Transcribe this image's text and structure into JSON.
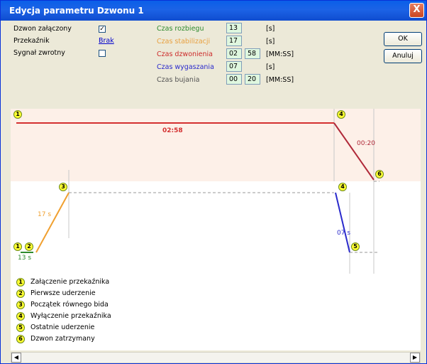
{
  "window": {
    "title": "Edycja parametru Dzwonu 1",
    "close_label": "X"
  },
  "left": {
    "bell_enabled_label": "Dzwon załączony",
    "relay_label": "Przekaźnik",
    "relay_value": "Brak",
    "feedback_label": "Sygnał zwrotny",
    "check_mark": "✓"
  },
  "params": {
    "rozbiegu": {
      "label": "Czas rozbiegu",
      "value": "13",
      "unit": "[s]",
      "color": "#2e8b2e"
    },
    "stabilizacji": {
      "label": "Czas stabilizacji",
      "value": "17",
      "unit": "[s]",
      "color": "#e8a040"
    },
    "dzwonienia": {
      "label": "Czas dzwonienia",
      "min": "02",
      "sec": "58",
      "unit": "[MM:SS]",
      "color": "#cc2a2a"
    },
    "wygaszania": {
      "label": "Czas wygaszania",
      "value": "07",
      "unit": "[s]",
      "color": "#2a2acc"
    },
    "bujania": {
      "label": "Czas bujania",
      "min": "00",
      "sec": "20",
      "unit": "[MM:SS]",
      "color": "#555555"
    }
  },
  "buttons": {
    "ok": "OK",
    "cancel": "Anuluj"
  },
  "chart": {
    "labels": {
      "ringing": "02:58",
      "swing": "00:20",
      "stabil": "17 s",
      "runup": "13 s",
      "fade": "07 s"
    },
    "markers": [
      "1",
      "2",
      "3",
      "4",
      "5",
      "6"
    ]
  },
  "legend": [
    {
      "num": "1",
      "text": "Załączenie przekaźnika"
    },
    {
      "num": "2",
      "text": "Pierwsze uderzenie"
    },
    {
      "num": "3",
      "text": "Początek równego bida"
    },
    {
      "num": "4",
      "text": "Wyłączenie przekaźnika"
    },
    {
      "num": "5",
      "text": "Ostatnie uderzenie"
    },
    {
      "num": "6",
      "text": "Dzwon zatrzymany"
    }
  ],
  "scroll": {
    "left": "◀",
    "right": "▶"
  }
}
